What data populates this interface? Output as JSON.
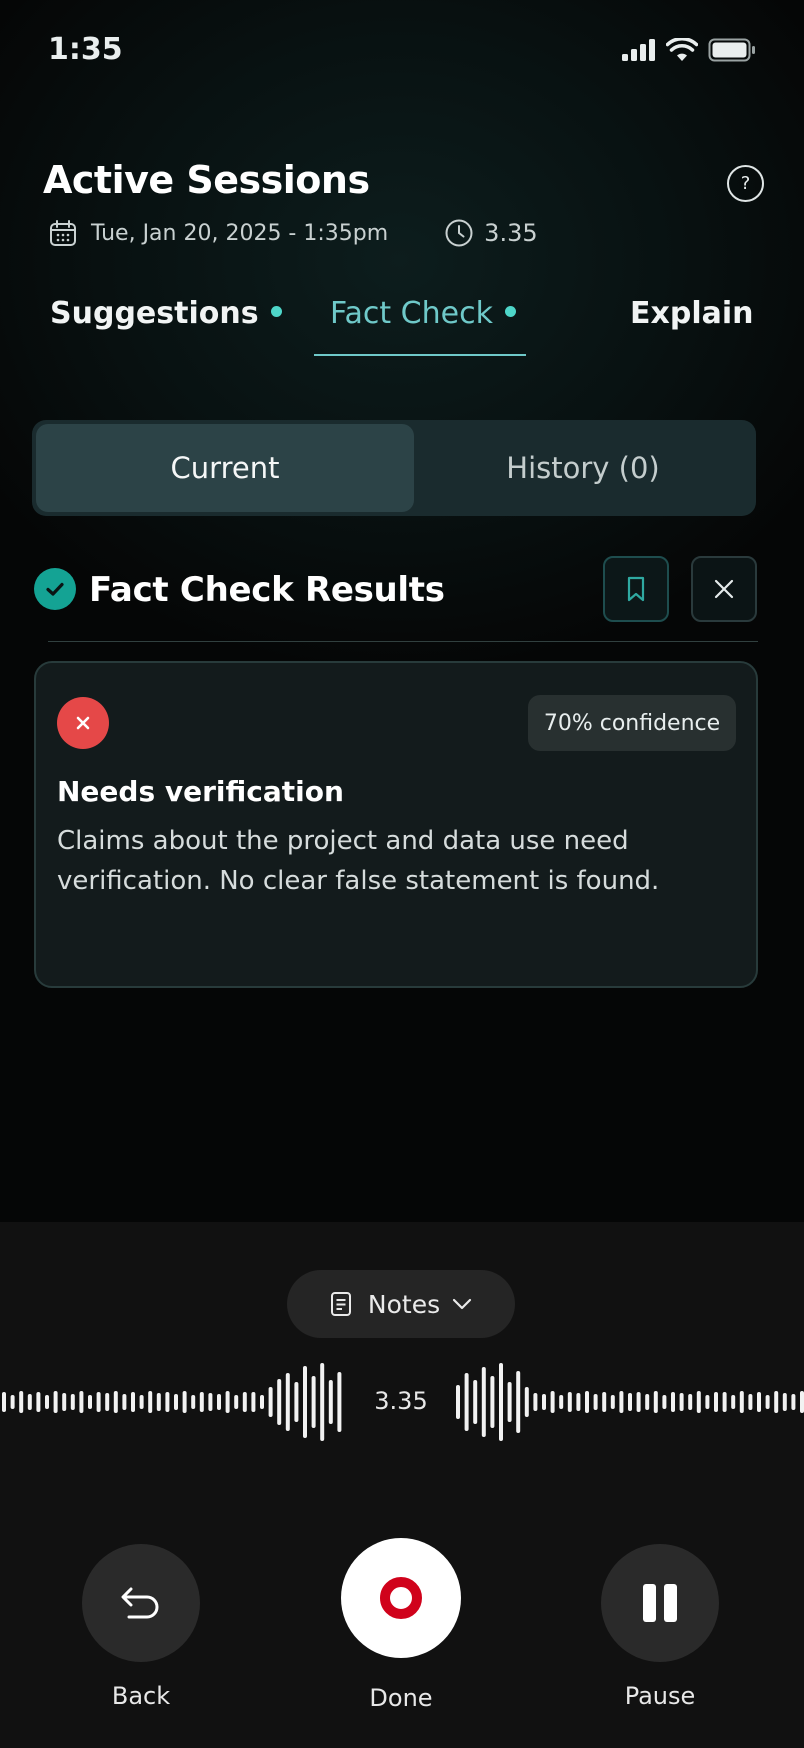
{
  "status_bar": {
    "time": "1:35"
  },
  "header": {
    "title": "Active Sessions",
    "help_label": "?",
    "date": "Tue, Jan 20, 2025  - 1:35pm",
    "duration": "3.35"
  },
  "tabs": [
    {
      "label": "Suggestions",
      "has_dot": true,
      "active": false
    },
    {
      "label": "Fact Check",
      "has_dot": true,
      "active": true
    },
    {
      "label": "Explain",
      "has_dot": false,
      "active": false
    }
  ],
  "segments": {
    "current": "Current",
    "history": "History (0)"
  },
  "results": {
    "title": "Fact Check Results",
    "card": {
      "confidence": "70% confidence",
      "heading": "Needs verification",
      "body": "Claims about the project and data use need verification. No clear false statement is found."
    }
  },
  "player": {
    "notes_label": "Notes",
    "time": "3.35",
    "back_label": "Back",
    "done_label": "Done",
    "pause_label": "Pause"
  },
  "colors": {
    "accent": "#4ed6c9",
    "active_tab": "#6fc9c9",
    "success": "#14a394",
    "error": "#e54848",
    "record": "#d0021b"
  }
}
